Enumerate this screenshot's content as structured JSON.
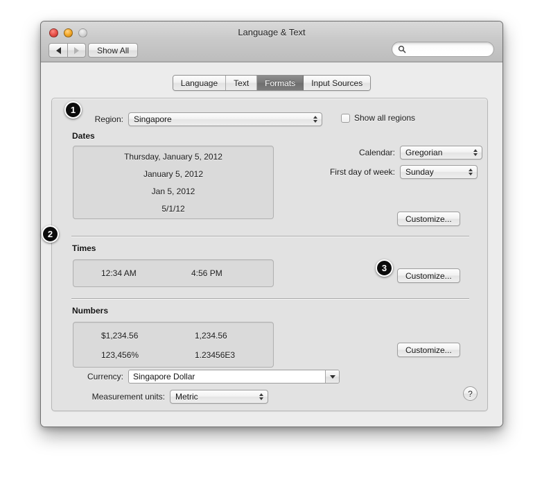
{
  "window": {
    "title": "Language & Text",
    "traffic_lights": [
      "close-button",
      "minimize-button",
      "zoom-button"
    ]
  },
  "toolbar": {
    "back_icon": "back-arrow-icon",
    "forward_icon": "forward-arrow-icon",
    "show_all_label": "Show All",
    "search_icon": "search-icon",
    "search_value": "",
    "search_placeholder": ""
  },
  "tabs": [
    {
      "label": "Language",
      "selected": false
    },
    {
      "label": "Text",
      "selected": false
    },
    {
      "label": "Formats",
      "selected": true
    },
    {
      "label": "Input Sources",
      "selected": false
    }
  ],
  "formats": {
    "region_label": "Region:",
    "region_value": "Singapore",
    "show_all_regions_label": "Show all regions",
    "show_all_regions_checked": false,
    "dates": {
      "heading": "Dates",
      "samples": [
        "Thursday, January 5, 2012",
        "January 5, 2012",
        "Jan 5, 2012",
        "5/1/12"
      ],
      "calendar_label": "Calendar:",
      "calendar_value": "Gregorian",
      "first_day_label": "First day of week:",
      "first_day_value": "Sunday",
      "customize_label": "Customize..."
    },
    "times": {
      "heading": "Times",
      "samples": [
        "12:34 AM",
        "4:56 PM"
      ],
      "customize_label": "Customize..."
    },
    "numbers": {
      "heading": "Numbers",
      "samples": [
        "$1,234.56",
        "1,234.56",
        "123,456%",
        "1.23456E3"
      ],
      "customize_label": "Customize..."
    },
    "currency_label": "Currency:",
    "currency_value": "Singapore Dollar",
    "measurement_label": "Measurement units:",
    "measurement_value": "Metric",
    "help_label": "?"
  },
  "callouts": [
    {
      "number": "1",
      "target": "region-popup"
    },
    {
      "number": "2",
      "target": "times-section"
    },
    {
      "number": "3",
      "target": "times-customize-button"
    }
  ],
  "colors": {
    "window_chrome": "#c9c9c9",
    "body_background": "#ececec",
    "panel_background": "#e2e2e2",
    "selected_tab": "#787878",
    "field_background": "#dadada",
    "badge_background": "#0c0c0c"
  }
}
